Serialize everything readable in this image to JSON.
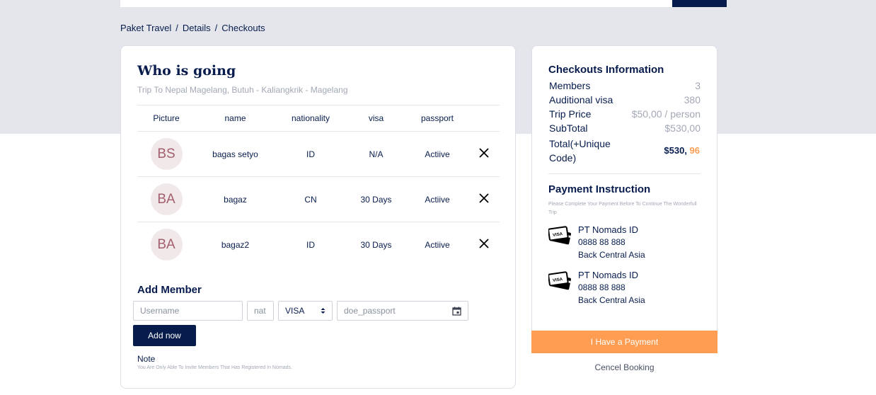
{
  "breadcrumb": {
    "items": [
      "Paket Travel",
      "Details",
      "Checkouts"
    ],
    "separator": "/"
  },
  "who": {
    "title": "Who is going",
    "subtitle": "Trip To Nepal Magelang, Butuh - Kaliangkrik - Magelang",
    "columns": [
      "Picture",
      "name",
      "nationality",
      "visa",
      "passport"
    ],
    "members": [
      {
        "initials": "BS",
        "name": "bagas setyo",
        "nationality": "ID",
        "visa": "N/A",
        "passport": "Actiive"
      },
      {
        "initials": "BA",
        "name": "bagaz",
        "nationality": "CN",
        "visa": "30 Days",
        "passport": "Actiive"
      },
      {
        "initials": "BA",
        "name": "bagaz2",
        "nationality": "ID",
        "visa": "30 Days",
        "passport": "Actiive"
      }
    ]
  },
  "add_member": {
    "title": "Add Member",
    "username_placeholder": "Username",
    "nationality_placeholder": "nat",
    "visa_selected": "VISA",
    "passport_placeholder": "doe_passport",
    "button": "Add now",
    "note_title": "Note",
    "note_text": "You Are Only Able To Invite Members That Has Registered In Nomads."
  },
  "checkout": {
    "title": "Checkouts Information",
    "rows": [
      {
        "label": "Members",
        "value": "3"
      },
      {
        "label": "Auditional visa",
        "value": "380"
      },
      {
        "label": "Trip Price",
        "value": "$50,00 / person"
      },
      {
        "label": "SubTotal",
        "value": "$530,00"
      }
    ],
    "total_label": "Total(+Unique Code)",
    "total_main": "$530, ",
    "total_unique": "96"
  },
  "payment": {
    "title": "Payment Instruction",
    "description": "Please Complete Your Payment Before To Continue The Wonderfull Trip",
    "banks": [
      {
        "name": "PT Nomads ID",
        "number": "0888 88 888",
        "branch": "Back Central Asia"
      },
      {
        "name": "PT Nomads ID",
        "number": "0888 88 888",
        "branch": "Back Central Asia"
      }
    ],
    "pay_button": "I Have a Payment",
    "cancel_link": "Cencel Booking"
  },
  "colors": {
    "navy": "#071c4d",
    "orange": "#ff9e53",
    "band": "#e5e6ec"
  }
}
